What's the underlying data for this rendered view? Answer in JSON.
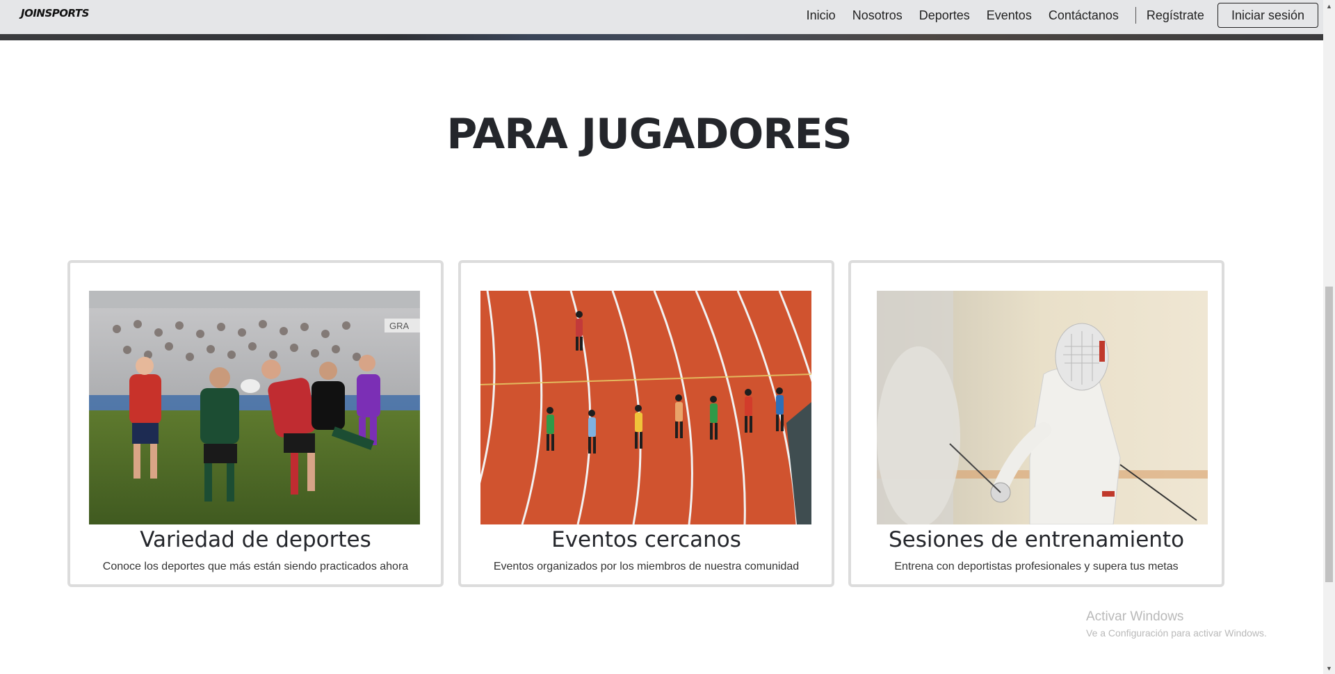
{
  "navbar": {
    "brand": "JOINSPORTS",
    "links": [
      "Inicio",
      "Nosotros",
      "Deportes",
      "Eventos",
      "Contáctanos"
    ],
    "register": "Regístrate",
    "login": "Iniciar sesión"
  },
  "section": {
    "title": "PARA JUGADORES"
  },
  "cards": [
    {
      "title": "Variedad de deportes",
      "description": "Conoce los deportes que más están siendo practicados ahora"
    },
    {
      "title": "Eventos cercanos",
      "description": "Eventos organizados por los miembros de nuestra comunidad"
    },
    {
      "title": "Sesiones de entrenamiento",
      "description": "Entrena con deportistas profesionales y supera tus metas"
    }
  ],
  "watermark": {
    "title": "Activar Windows",
    "subtitle": "Ve a Configuración para activar Windows."
  },
  "icons": {
    "scroll_up": "scroll-up-arrow-icon",
    "scroll_down": "scroll-down-arrow-icon"
  }
}
